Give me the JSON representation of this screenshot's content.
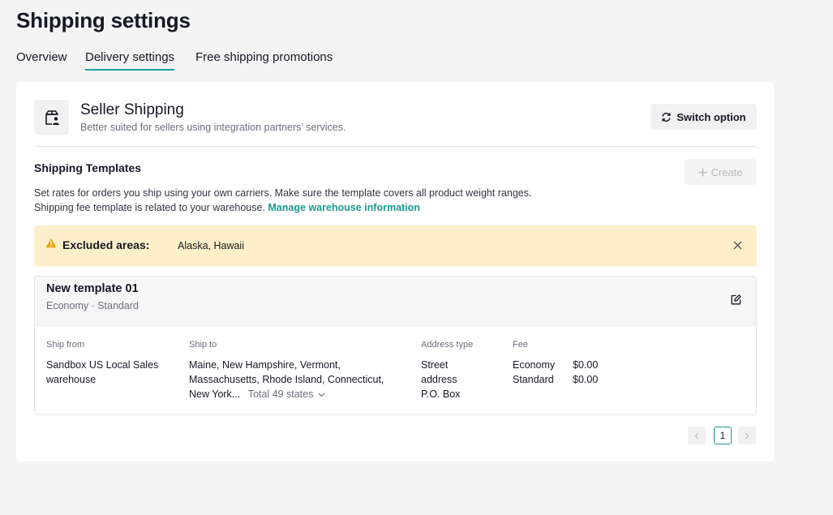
{
  "page": {
    "title": "Shipping settings"
  },
  "tabs": [
    {
      "label": "Overview"
    },
    {
      "label": "Delivery settings"
    },
    {
      "label": "Free shipping promotions"
    }
  ],
  "option": {
    "title": "Seller Shipping",
    "description": "Better suited for sellers using integration partners’ services.",
    "switch_label": "Switch option",
    "icon": "shipping-box-user-icon"
  },
  "templates_section": {
    "title": "Shipping Templates",
    "create_label": "Create",
    "desc_line1": "Set rates for orders you ship using your own carriers. Make sure the template covers all product weight ranges.",
    "desc_line2": "Shipping fee template is related to your warehouse.",
    "link_label": "Manage warehouse information"
  },
  "alert": {
    "label": "Excluded areas:",
    "value": "Alaska, Hawaii",
    "bg_color": "#fdefc9",
    "icon_color": "#e8a60f"
  },
  "template": {
    "name": "New template 01",
    "meta": "Economy · Standard",
    "columns": {
      "ship_from": "Ship from",
      "ship_to": "Ship to",
      "address_type": "Address type",
      "fee": "Fee"
    },
    "ship_from": {
      "line1": "Sandbox US Local Sales",
      "line2": "warehouse"
    },
    "ship_to": {
      "line1": "Maine, New Hampshire, Vermont,",
      "line2": "Massachusetts, Rhode Island, Connecticut,",
      "line3": "New York...",
      "total": "Total 49 states"
    },
    "address_types": {
      "line1": "Street",
      "line2": "address",
      "line3": "P.O. Box"
    },
    "fees": [
      {
        "name": "Economy",
        "amount": "$0.00"
      },
      {
        "name": "Standard",
        "amount": "$0.00"
      }
    ]
  },
  "pagination": {
    "current": "1"
  },
  "colors": {
    "accent": "#1aa39a",
    "link": "#1a9a93"
  }
}
